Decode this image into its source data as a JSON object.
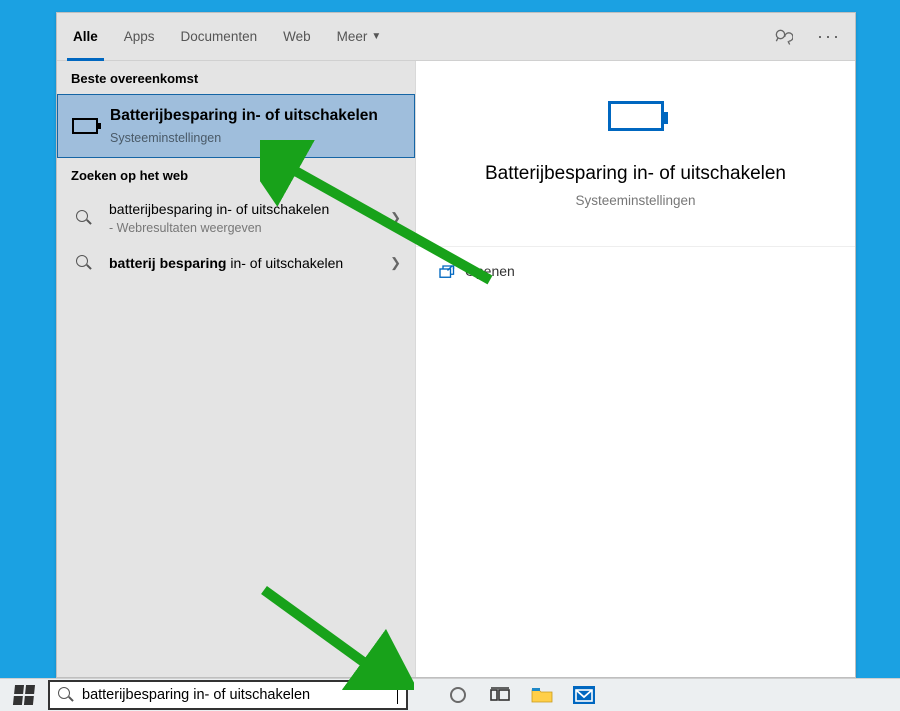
{
  "header": {
    "tabs": {
      "all": "Alle",
      "apps": "Apps",
      "documents": "Documenten",
      "web": "Web",
      "more": "Meer"
    }
  },
  "left": {
    "best_match_label": "Beste overeenkomst",
    "best": {
      "title": "Batterijbesparing in- of uitschakelen",
      "subtitle": "Systeeminstellingen"
    },
    "web_label": "Zoeken op het web",
    "web1": {
      "title": "batterijbesparing in- of uitschakelen",
      "subtitle": "- Webresultaten weergeven"
    },
    "web2": {
      "title_bold": "batterij besparing",
      "title_rest": " in- of uitschakelen"
    }
  },
  "preview": {
    "title": "Batterijbesparing in- of uitschakelen",
    "subtitle": "Systeeminstellingen",
    "open_label": "Openen"
  },
  "taskbar": {
    "search_query": "batterijbesparing in- of uitschakelen"
  }
}
